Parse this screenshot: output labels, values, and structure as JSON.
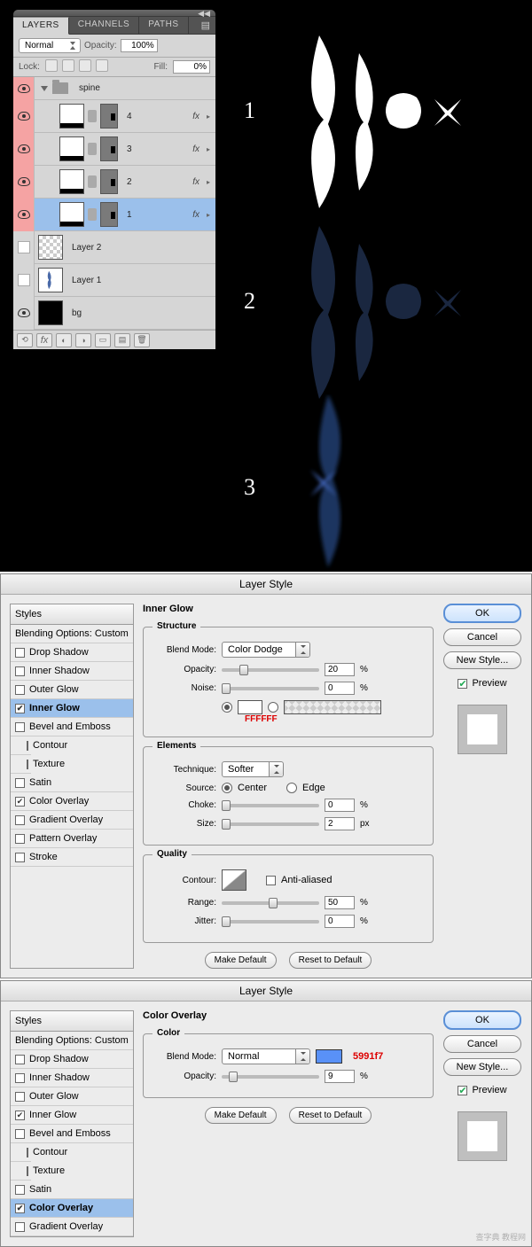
{
  "panel": {
    "tabs": [
      "LAYERS",
      "CHANNELS",
      "PATHS"
    ],
    "blendMode": "Normal",
    "opacityLabel": "Opacity:",
    "opacityValue": "100%",
    "lockLabel": "Lock:",
    "fillLabel": "Fill:",
    "fillValue": "0%",
    "group": "spine",
    "layers": [
      {
        "name": "4",
        "fx": true
      },
      {
        "name": "3",
        "fx": true
      },
      {
        "name": "2",
        "fx": true
      },
      {
        "name": "1",
        "fx": true,
        "selected": true
      }
    ],
    "extraLayers": [
      {
        "name": "Layer 2",
        "thumb": "checker"
      },
      {
        "name": "Layer 1",
        "thumb": "layer1"
      },
      {
        "name": "bg",
        "thumb": "black",
        "visible": true
      }
    ]
  },
  "canvasNumbers": [
    "1",
    "2",
    "3"
  ],
  "dlg1": {
    "title": "Layer Style",
    "stylesHdr": "Styles",
    "blendingOptions": "Blending Options: Custom",
    "items": [
      {
        "label": "Drop Shadow",
        "checked": false
      },
      {
        "label": "Inner Shadow",
        "checked": false
      },
      {
        "label": "Outer Glow",
        "checked": false
      },
      {
        "label": "Inner Glow",
        "checked": true,
        "selected": true
      },
      {
        "label": "Bevel and Emboss",
        "checked": false
      },
      {
        "label": "Contour",
        "checked": false,
        "indent": true
      },
      {
        "label": "Texture",
        "checked": false,
        "indent": true
      },
      {
        "label": "Satin",
        "checked": false
      },
      {
        "label": "Color Overlay",
        "checked": true
      },
      {
        "label": "Gradient Overlay",
        "checked": false
      },
      {
        "label": "Pattern Overlay",
        "checked": false
      },
      {
        "label": "Stroke",
        "checked": false
      }
    ],
    "group": "Inner Glow",
    "structure": "Structure",
    "blendModeLabel": "Blend Mode:",
    "blendModeValue": "Color Dodge",
    "opacityLabel": "Opacity:",
    "opacityValue": "20",
    "noiseLabel": "Noise:",
    "noiseValue": "0",
    "colorHex": "FFFFFF",
    "elements": "Elements",
    "techniqueLabel": "Technique:",
    "techniqueValue": "Softer",
    "sourceLabel": "Source:",
    "sourceCenter": "Center",
    "sourceEdge": "Edge",
    "chokeLabel": "Choke:",
    "chokeValue": "0",
    "sizeLabel": "Size:",
    "sizeValue": "2",
    "sizeUnit": "px",
    "quality": "Quality",
    "contourLabel": "Contour:",
    "antiAliased": "Anti-aliased",
    "rangeLabel": "Range:",
    "rangeValue": "50",
    "jitterLabel": "Jitter:",
    "jitterValue": "0",
    "makeDefault": "Make Default",
    "resetDefault": "Reset to Default",
    "ok": "OK",
    "cancel": "Cancel",
    "newStyle": "New Style...",
    "preview": "Preview",
    "pct": "%"
  },
  "dlg2": {
    "title": "Layer Style",
    "stylesHdr": "Styles",
    "blendingOptions": "Blending Options: Custom",
    "items": [
      {
        "label": "Drop Shadow",
        "checked": false
      },
      {
        "label": "Inner Shadow",
        "checked": false
      },
      {
        "label": "Outer Glow",
        "checked": false
      },
      {
        "label": "Inner Glow",
        "checked": true
      },
      {
        "label": "Bevel and Emboss",
        "checked": false
      },
      {
        "label": "Contour",
        "checked": false,
        "indent": true
      },
      {
        "label": "Texture",
        "checked": false,
        "indent": true
      },
      {
        "label": "Satin",
        "checked": false
      },
      {
        "label": "Color Overlay",
        "checked": true,
        "selected": true
      },
      {
        "label": "Gradient Overlay",
        "checked": false
      }
    ],
    "group": "Color Overlay",
    "color": "Color",
    "blendModeLabel": "Blend Mode:",
    "blendModeValue": "Normal",
    "colorHex": "5991f7",
    "opacityLabel": "Opacity:",
    "opacityValue": "9",
    "pct": "%",
    "makeDefault": "Make Default",
    "resetDefault": "Reset to Default",
    "ok": "OK",
    "cancel": "Cancel",
    "newStyle": "New Style...",
    "preview": "Preview"
  },
  "watermark": "查字典 教程网"
}
